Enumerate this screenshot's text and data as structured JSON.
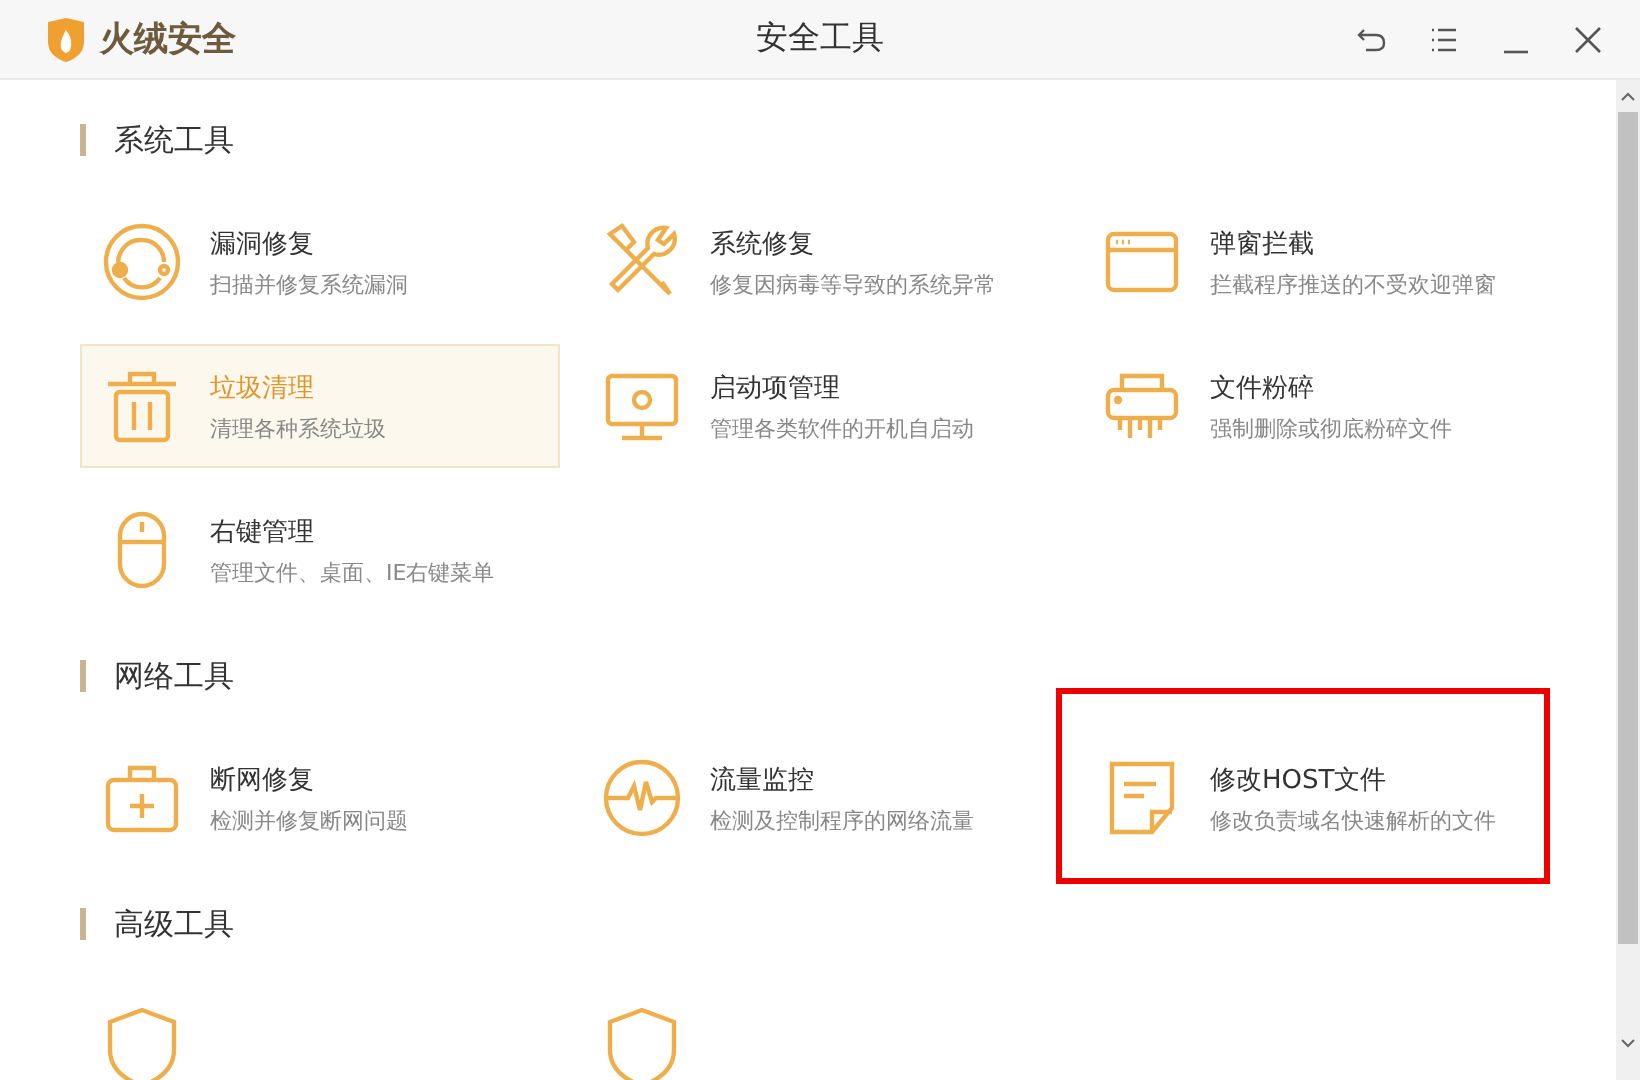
{
  "window": {
    "app_name": "火绒安全",
    "title": "安全工具"
  },
  "sections": [
    {
      "title": "系统工具",
      "items": [
        {
          "kind": "bug",
          "title": "漏洞修复",
          "description": "扫描并修复系统漏洞",
          "selected": false,
          "highlighted": false
        },
        {
          "kind": "tools",
          "title": "系统修复",
          "description": "修复因病毒等导致的系统异常",
          "selected": false,
          "highlighted": false
        },
        {
          "kind": "popup",
          "title": "弹窗拦截",
          "description": "拦截程序推送的不受欢迎弹窗",
          "selected": false,
          "highlighted": false
        },
        {
          "kind": "trash",
          "title": "垃圾清理",
          "description": "清理各种系统垃圾",
          "selected": true,
          "highlighted": false
        },
        {
          "kind": "monitor",
          "title": "启动项管理",
          "description": "管理各类软件的开机自启动",
          "selected": false,
          "highlighted": false
        },
        {
          "kind": "shredder",
          "title": "文件粉碎",
          "description": "强制删除或彻底粉碎文件",
          "selected": false,
          "highlighted": false
        },
        {
          "kind": "mouse",
          "title": "右键管理",
          "description": "管理文件、桌面、IE右键菜单",
          "selected": false,
          "highlighted": false
        }
      ]
    },
    {
      "title": "网络工具",
      "items": [
        {
          "kind": "kit",
          "title": "断网修复",
          "description": "检测并修复断网问题",
          "selected": false,
          "highlighted": false
        },
        {
          "kind": "pulse",
          "title": "流量监控",
          "description": "检测及控制程序的网络流量",
          "selected": false,
          "highlighted": false
        },
        {
          "kind": "note",
          "title": "修改HOST文件",
          "description": "修改负责域名快速解析的文件",
          "selected": false,
          "highlighted": true
        }
      ]
    },
    {
      "title": "高级工具",
      "items": [
        {
          "kind": "shield",
          "selected": false,
          "highlighted": false
        },
        {
          "kind": "shield",
          "selected": false,
          "highlighted": false
        }
      ]
    }
  ]
}
